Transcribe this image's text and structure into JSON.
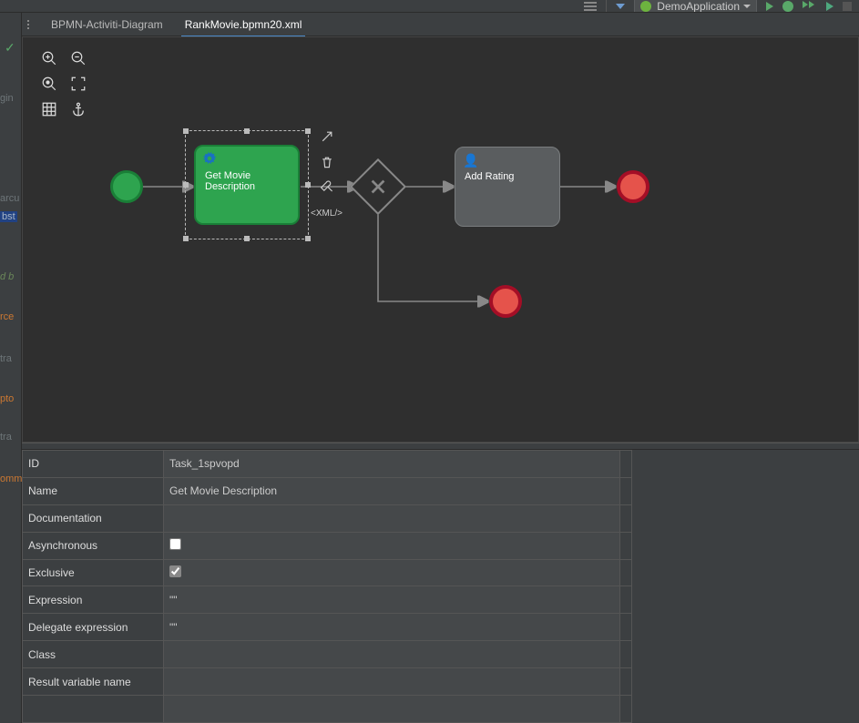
{
  "menubar": {
    "run_config_label": "DemoApplication"
  },
  "tabs": {
    "tab1": "BPMN-Activiti-Diagram",
    "tab2": "RankMovie.bpmn20.xml"
  },
  "gutter": {
    "f1": "gin",
    "f2": "arcu",
    "f3": "bst",
    "f4": "d b",
    "f5": "rce",
    "f6": "tra",
    "f7": "pto",
    "f8": "tra",
    "f9": "omm"
  },
  "bpmn": {
    "service_task_label": "Get Movie\nDescription",
    "user_task_label": "Add Rating",
    "xml_label": "<XML/>"
  },
  "props": {
    "rows": {
      "id": {
        "key": "ID",
        "val": "Task_1spvopd"
      },
      "name": {
        "key": "Name",
        "val": "Get Movie Description"
      },
      "doc": {
        "key": "Documentation",
        "val": ""
      },
      "async": {
        "key": "Asynchronous",
        "checked": false
      },
      "excl": {
        "key": "Exclusive",
        "checked": true
      },
      "expr": {
        "key": "Expression",
        "val": "\"\""
      },
      "dexpr": {
        "key": "Delegate expression",
        "val": "\"\""
      },
      "class": {
        "key": "Class",
        "val": ""
      },
      "rvar": {
        "key": "Result variable name",
        "val": ""
      }
    }
  }
}
